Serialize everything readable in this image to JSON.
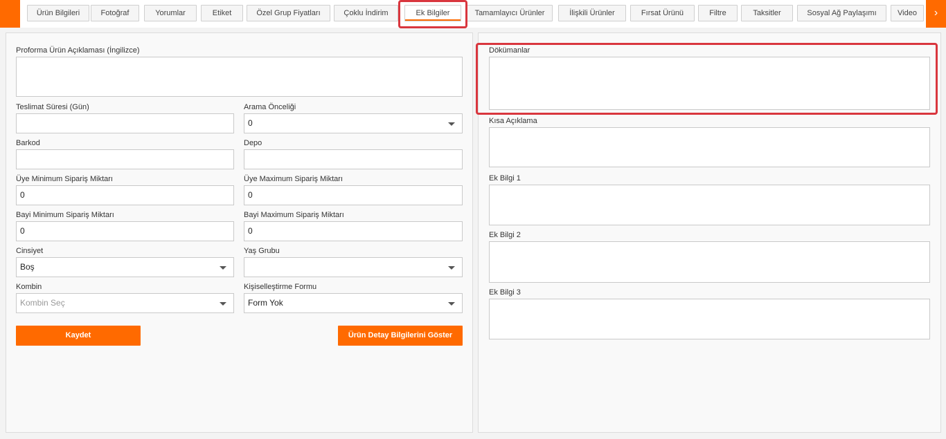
{
  "tabs": [
    {
      "label": "Ürün Bilgileri"
    },
    {
      "label": "Fotoğraf"
    },
    {
      "label": "Yorumlar"
    },
    {
      "label": "Etiket"
    },
    {
      "label": "Özel Grup Fiyatları"
    },
    {
      "label": "Çoklu İndirim"
    },
    {
      "label": "Ek Bilgiler"
    },
    {
      "label": "Tamamlayıcı Ürünler"
    },
    {
      "label": "İlişkili Ürünler"
    },
    {
      "label": "Fırsat Ürünü"
    },
    {
      "label": "Filtre"
    },
    {
      "label": "Taksitler"
    },
    {
      "label": "Sosyal Ağ Paylaşımı"
    },
    {
      "label": "Video"
    }
  ],
  "active_tab": "Ek Bilgiler",
  "nav": {
    "right_arrow": "›"
  },
  "left_form": {
    "proforma_label": "Proforma Ürün Açıklaması (İngilizce)",
    "teslimat_label": "Teslimat Süresi (Gün)",
    "teslimat_value": "",
    "arama_label": "Arama Önceliği",
    "arama_value": "0",
    "barkod_label": "Barkod",
    "barkod_value": "",
    "depo_label": "Depo",
    "depo_value": "",
    "uye_min_label": "Üye Minimum Sipariş Miktarı",
    "uye_min_value": "0",
    "uye_max_label": "Üye Maximum Sipariş Miktarı",
    "uye_max_value": "0",
    "bayi_min_label": "Bayi Minimum Sipariş Miktarı",
    "bayi_min_value": "0",
    "bayi_max_label": "Bayi Maximum Sipariş Miktarı",
    "bayi_max_value": "0",
    "cinsiyet_label": "Cinsiyet",
    "cinsiyet_value": "Boş",
    "yas_label": "Yaş Grubu",
    "yas_value": "",
    "kombin_label": "Kombin",
    "kombin_placeholder": "Kombin Seç",
    "kisisel_label": "Kişiselleştirme Formu",
    "kisisel_value": "Form Yok",
    "save_label": "Kaydet",
    "details_label": "Ürün Detay Bilgilerini Göster"
  },
  "right_form": {
    "dokumanlar_label": "Dökümanlar",
    "kisa_label": "Kısa Açıklama",
    "ek1_label": "Ek Bilgi 1",
    "ek2_label": "Ek Bilgi 2",
    "ek3_label": "Ek Bilgi 3"
  },
  "colors": {
    "accent": "#ff6a00",
    "highlight": "#d9363e"
  }
}
